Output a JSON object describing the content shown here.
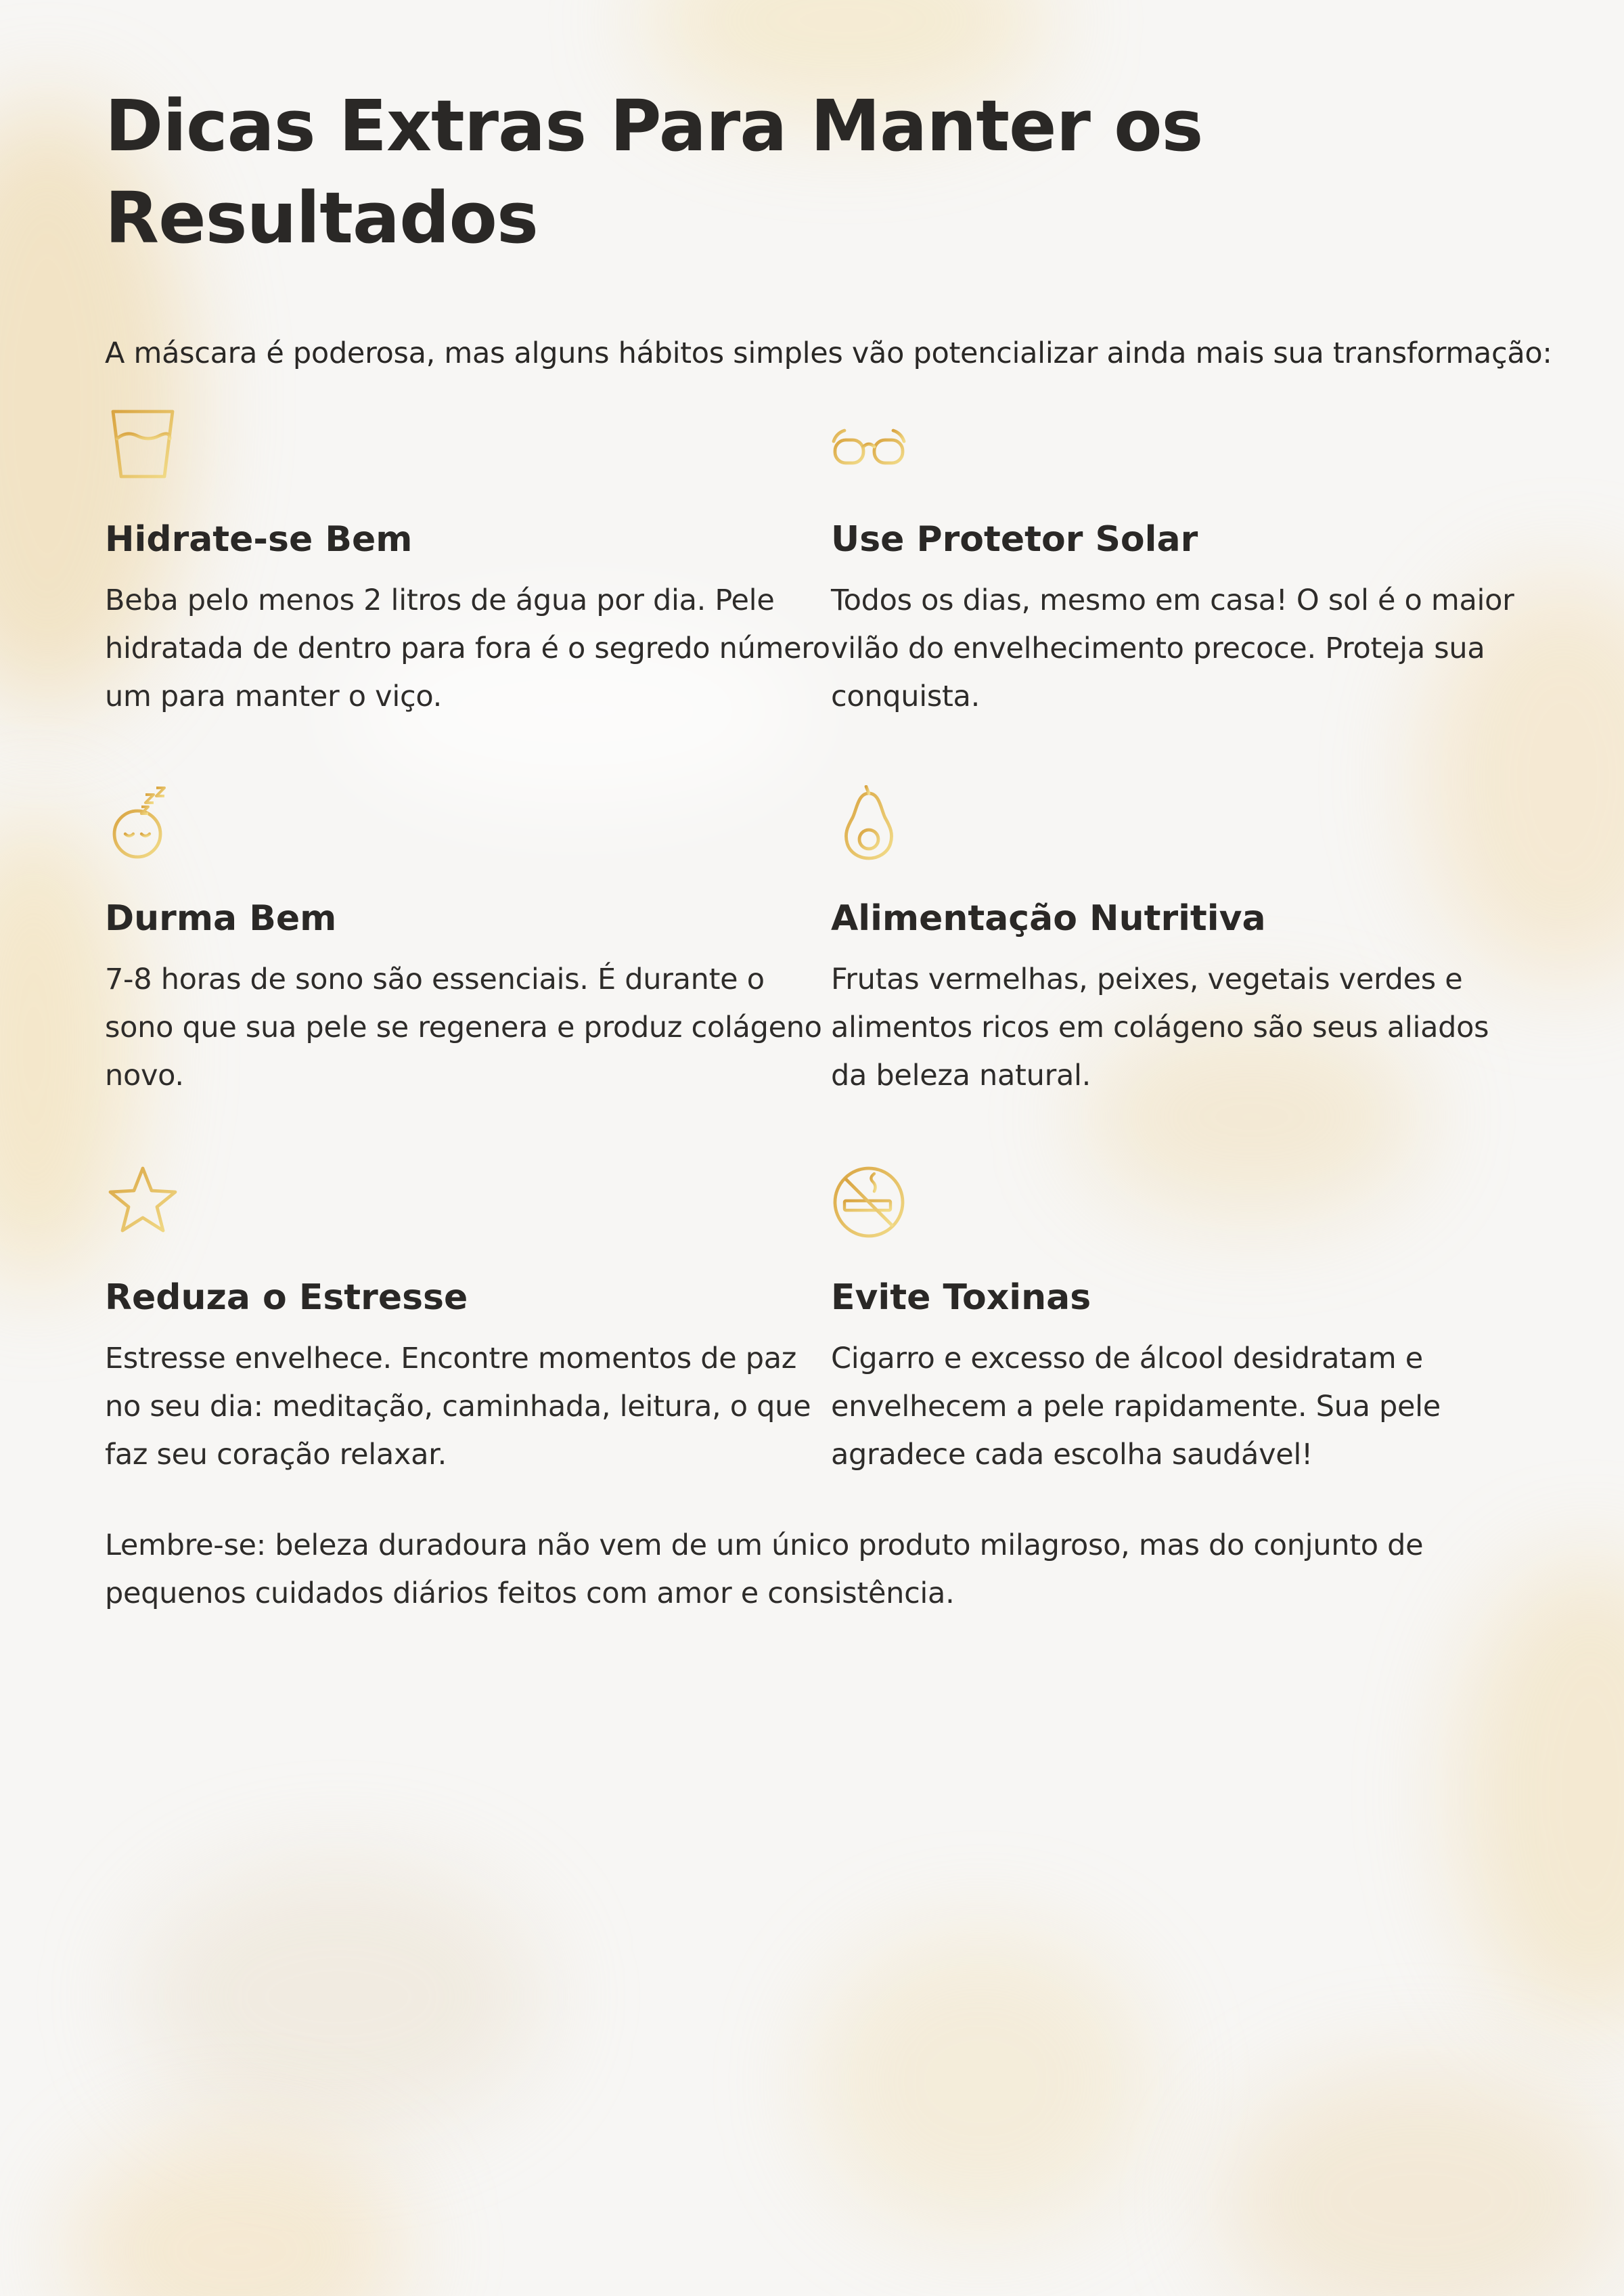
{
  "title": "Dicas Extras Para Manter os Resultados",
  "intro": "A máscara é poderosa, mas alguns hábitos simples vão potencializar ainda mais sua transformação:",
  "accent_colors": {
    "gold_light": "#f2dc8a",
    "gold_dark": "#d9a441"
  },
  "tips": [
    {
      "icon": "glass-of-water-icon",
      "title": "Hidrate-se Bem",
      "text": "Beba pelo menos 2 litros de água por dia. Pele hidratada de dentro para fora é o segredo número um para manter o viço."
    },
    {
      "icon": "sunglasses-icon",
      "title": "Use Protetor Solar",
      "text": "Todos os dias, mesmo em casa! O sol é o maior vilão do envelhecimento precoce. Proteja sua conquista."
    },
    {
      "icon": "sleeping-face-icon",
      "title": "Durma Bem",
      "text": "7-8 horas de sono são essenciais. É durante o sono que sua pele se regenera e produz colágeno novo."
    },
    {
      "icon": "avocado-icon",
      "title": "Alimentação Nutritiva",
      "text": "Frutas vermelhas, peixes, vegetais verdes e alimentos ricos em colágeno são seus aliados da beleza natural."
    },
    {
      "icon": "star-icon",
      "title": "Reduza o Estresse",
      "text": "Estresse envelhece. Encontre momentos de paz no seu dia: meditação, caminhada, leitura, o que faz seu coração relaxar."
    },
    {
      "icon": "no-smoking-icon",
      "title": "Evite Toxinas",
      "text": "Cigarro e excesso de álcool desidratam e envelhecem a pele rapidamente. Sua pele agradece cada escolha saudável!"
    }
  ],
  "closing": "Lembre-se: beleza duradoura não vem de um único produto milagroso, mas do conjunto de pequenos cuidados diários feitos com amor e consistência."
}
